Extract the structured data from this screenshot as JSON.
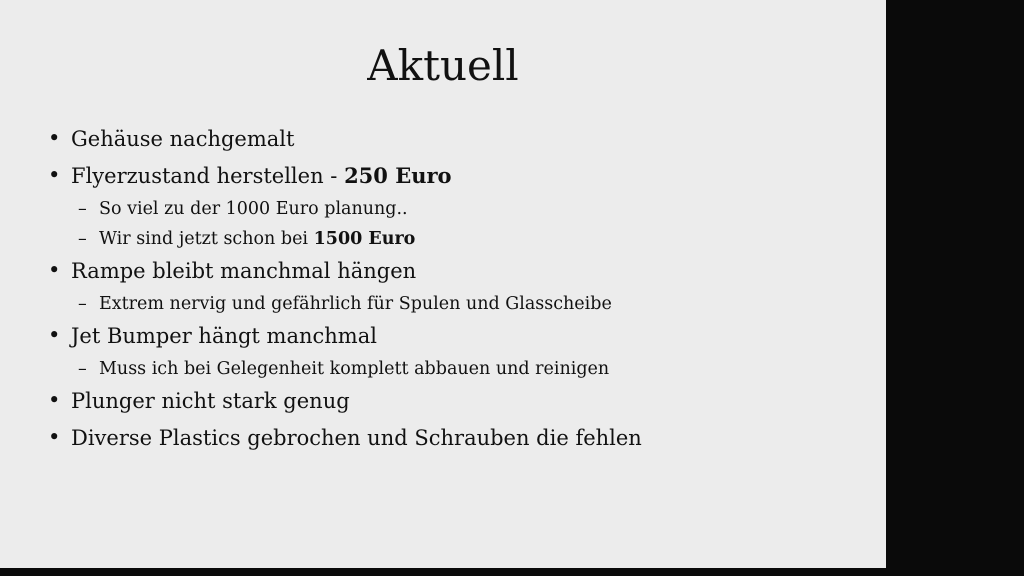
{
  "slide": {
    "title": "Aktuell",
    "items": [
      {
        "level": 1,
        "bullet": "•",
        "text": "Gehäuse nachgemalt",
        "bold": ""
      },
      {
        "level": 1,
        "bullet": "•",
        "text": "Flyerzustand herstellen - ",
        "bold": "250 Euro"
      },
      {
        "level": 2,
        "bullet": "–",
        "text": "So viel zu der 1000 Euro planung..",
        "bold": ""
      },
      {
        "level": 2,
        "bullet": "–",
        "text": "Wir sind jetzt schon bei ",
        "bold": "1500 Euro"
      },
      {
        "level": 1,
        "bullet": "•",
        "text": "Rampe bleibt manchmal hängen",
        "bold": ""
      },
      {
        "level": 2,
        "bullet": "–",
        "text": "Extrem nervig und gefährlich für Spulen und Glasscheibe",
        "bold": ""
      },
      {
        "level": 1,
        "bullet": "•",
        "text": "Jet Bumper hängt manchmal",
        "bold": ""
      },
      {
        "level": 2,
        "bullet": "–",
        "text": "Muss ich bei Gelegenheit komplett abbauen und reinigen",
        "bold": ""
      },
      {
        "level": 1,
        "bullet": "•",
        "text": "Plunger nicht stark genug",
        "bold": ""
      },
      {
        "level": 1,
        "bullet": "•",
        "text": "Diverse Plastics gebrochen und Schrauben die fehlen",
        "bold": ""
      }
    ]
  }
}
